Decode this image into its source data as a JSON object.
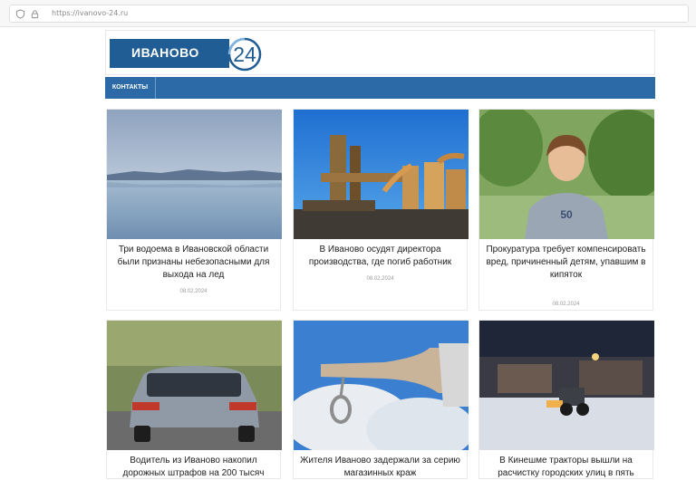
{
  "browser": {
    "url": "https://ivanovo-24.ru"
  },
  "site": {
    "logo_text": "ИВАНОВО",
    "logo_number": "24",
    "nav": [
      "КОНТАКТЫ"
    ]
  },
  "articles": [
    {
      "title": "Три водоема в Ивановской области были признаны небезопасными для выхода на лед",
      "date": "08.02.2024"
    },
    {
      "title": "В Иваново осудят директора производства, где погиб работник",
      "date": "08.02.2024"
    },
    {
      "title": "Прокуратура требует компенсировать вред, причиненный детям, упавшим в кипяток",
      "date": "08.02.2024"
    },
    {
      "title": "Водитель из Иваново накопил дорожных штрафов на 200 тысяч",
      "date": ""
    },
    {
      "title": "Жителя Иваново задержали за серию магазинных краж",
      "date": ""
    },
    {
      "title": "В Кинешме тракторы вышли на расчистку городских улиц в пять",
      "date": ""
    }
  ],
  "colors": {
    "brand": "#1f5d94",
    "nav": "#2b6aa6"
  }
}
